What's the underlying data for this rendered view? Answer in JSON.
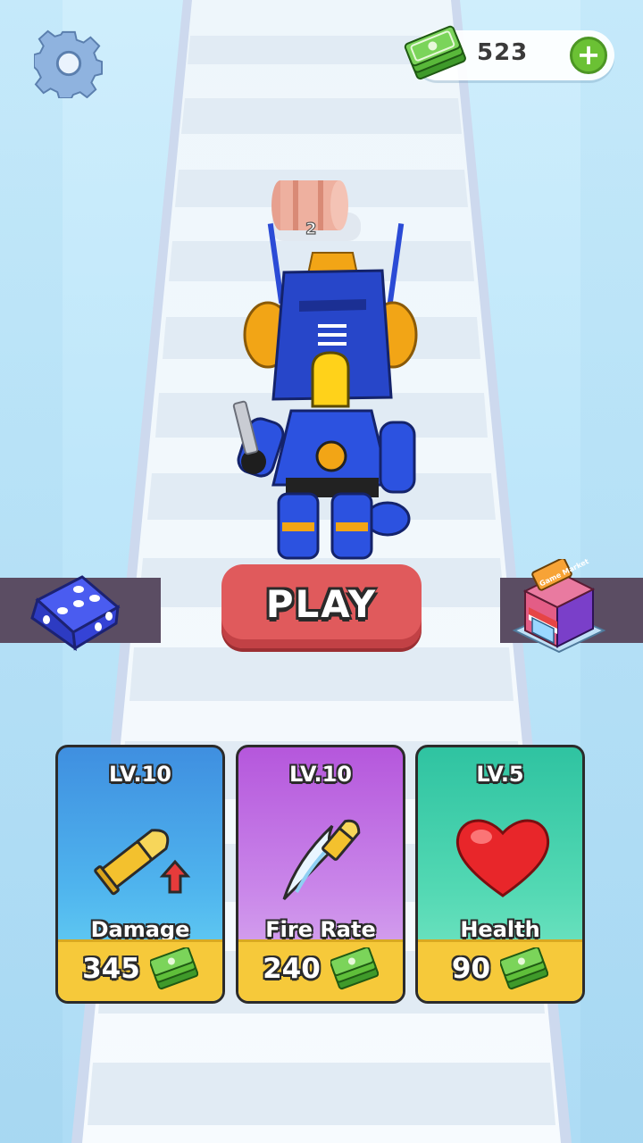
{
  "currency": {
    "amount": "523",
    "add_label": "+"
  },
  "barrel": {
    "count": "2"
  },
  "play_button": {
    "label": "PLAY"
  },
  "market": {
    "sign": "Game Market"
  },
  "upgrades": [
    {
      "level": "LV.10",
      "title": "Damage",
      "price": "345",
      "icon": "bullet-up-icon"
    },
    {
      "level": "LV.10",
      "title": "Fire Rate",
      "price": "240",
      "icon": "flying-bullet-icon"
    },
    {
      "level": "LV.5",
      "title": "Health",
      "price": "90",
      "icon": "heart-icon"
    }
  ],
  "colors": {
    "play": "#e05a5c",
    "damage_card": "#3f8fe0",
    "fire_rate_card": "#b557dc",
    "health_card": "#2fc3a1",
    "price_bar": "#f6c93a",
    "cash": "#5fbf3a"
  }
}
